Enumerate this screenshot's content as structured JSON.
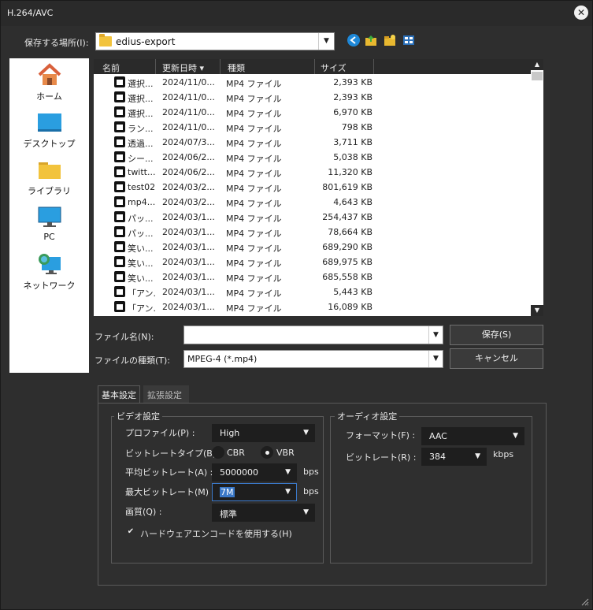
{
  "window": {
    "title": "H.264/AVC",
    "close_glyph": "✕"
  },
  "location": {
    "label": "保存する場所(I):",
    "value": "edius-export"
  },
  "places": [
    {
      "label": "ホーム",
      "icon": "home-icon"
    },
    {
      "label": "デスクトップ",
      "icon": "desktop-icon"
    },
    {
      "label": "ライブラリ",
      "icon": "library-icon"
    },
    {
      "label": "PC",
      "icon": "pc-icon"
    },
    {
      "label": "ネットワーク",
      "icon": "network-icon"
    }
  ],
  "file_table": {
    "columns": [
      "名前",
      "更新日時",
      "種類",
      "サイズ"
    ],
    "sort_indicator": "▾",
    "rows": [
      {
        "name": "選択...",
        "date": "2024/11/0...",
        "type": "MP4 ファイル",
        "size": "2,393 KB"
      },
      {
        "name": "選択...",
        "date": "2024/11/0...",
        "type": "MP4 ファイル",
        "size": "2,393 KB"
      },
      {
        "name": "選択...",
        "date": "2024/11/0...",
        "type": "MP4 ファイル",
        "size": "6,970 KB"
      },
      {
        "name": "ラン...",
        "date": "2024/11/0...",
        "type": "MP4 ファイル",
        "size": "798 KB"
      },
      {
        "name": "透過...",
        "date": "2024/07/3...",
        "type": "MP4 ファイル",
        "size": "3,711 KB"
      },
      {
        "name": "シー...",
        "date": "2024/06/2...",
        "type": "MP4 ファイル",
        "size": "5,038 KB"
      },
      {
        "name": "twitt...",
        "date": "2024/06/2...",
        "type": "MP4 ファイル",
        "size": "11,320 KB"
      },
      {
        "name": "test02",
        "date": "2024/03/2...",
        "type": "MP4 ファイル",
        "size": "801,619 KB"
      },
      {
        "name": "mp4...",
        "date": "2024/03/2...",
        "type": "MP4 ファイル",
        "size": "4,643 KB"
      },
      {
        "name": "パッ...",
        "date": "2024/03/1...",
        "type": "MP4 ファイル",
        "size": "254,437 KB"
      },
      {
        "name": "パッ...",
        "date": "2024/03/1...",
        "type": "MP4 ファイル",
        "size": "78,664 KB"
      },
      {
        "name": "笑い...",
        "date": "2024/03/1...",
        "type": "MP4 ファイル",
        "size": "689,290 KB"
      },
      {
        "name": "笑い...",
        "date": "2024/03/1...",
        "type": "MP4 ファイル",
        "size": "689,975 KB"
      },
      {
        "name": "笑い...",
        "date": "2024/03/1...",
        "type": "MP4 ファイル",
        "size": "685,558 KB"
      },
      {
        "name": "「アン...",
        "date": "2024/03/1...",
        "type": "MP4 ファイル",
        "size": "5,443 KB"
      },
      {
        "name": "「アン...",
        "date": "2024/03/1...",
        "type": "MP4 ファイル",
        "size": "16,089 KB"
      }
    ]
  },
  "filename": {
    "label": "ファイル名(N):",
    "value": ""
  },
  "filetype": {
    "label": "ファイルの種類(T):",
    "value": "MPEG-4 (*.mp4)"
  },
  "buttons": {
    "save": "保存(S)",
    "cancel": "キャンセル"
  },
  "tabs": [
    {
      "label": "基本設定",
      "active": true
    },
    {
      "label": "拡張設定",
      "active": false
    }
  ],
  "video": {
    "group_title": "ビデオ設定",
    "profile": {
      "label": "プロファイル(P) :",
      "value": "High"
    },
    "bitrate_type": {
      "label": "ビットレートタイプ(B) :",
      "options": [
        "CBR",
        "VBR"
      ],
      "selected": "VBR"
    },
    "avg_bitrate": {
      "label": "平均ビットレート(A) :",
      "value": "5000000",
      "unit": "bps"
    },
    "max_bitrate": {
      "label": "最大ビットレート(M) :",
      "value": "7M",
      "unit": "bps"
    },
    "quality": {
      "label": "画質(Q) :",
      "value": "標準"
    },
    "hw_encode": {
      "label": "ハードウェアエンコードを使用する(H)",
      "checked": true
    }
  },
  "audio": {
    "group_title": "オーディオ設定",
    "format": {
      "label": "フォーマット(F) :",
      "value": "AAC"
    },
    "bitrate": {
      "label": "ビットレート(R) :",
      "value": "384",
      "unit": "kbps"
    }
  },
  "colors": {
    "bg": "#2e2e2e",
    "panel": "#2f2f2f",
    "select": "#1e1e1e",
    "selection": "#3a78c8"
  }
}
